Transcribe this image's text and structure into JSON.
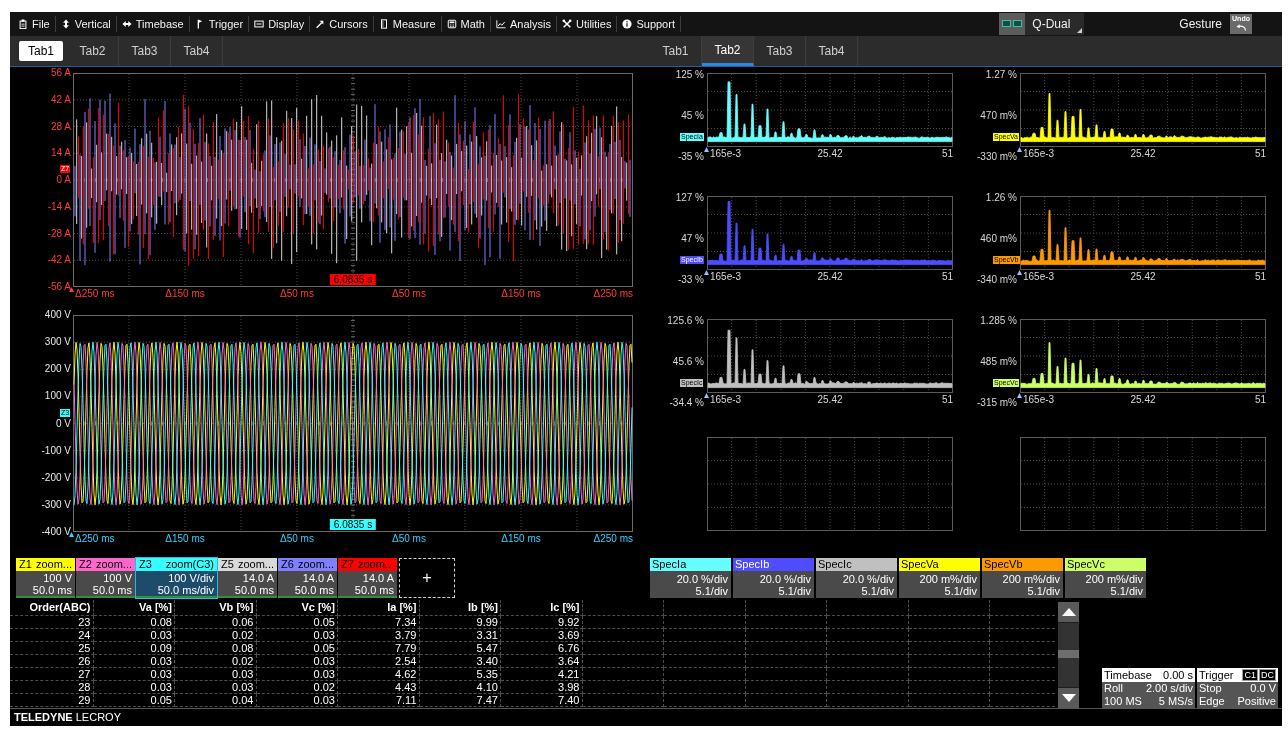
{
  "menu": {
    "items": [
      "File",
      "Vertical",
      "Timebase",
      "Trigger",
      "Display",
      "Cursors",
      "Measure",
      "Math",
      "Analysis",
      "Utilities",
      "Support"
    ],
    "display_mode": "Q-Dual",
    "gesture": "Gesture",
    "undo": "Undo"
  },
  "left_tabs": [
    {
      "label": "Tab1",
      "selected": true
    },
    {
      "label": "Tab2",
      "selected": false
    },
    {
      "label": "Tab3",
      "selected": false
    },
    {
      "label": "Tab4",
      "selected": false
    }
  ],
  "right_tabs": [
    {
      "label": "Tab1",
      "selected": false
    },
    {
      "label": "Tab2",
      "selected": true
    },
    {
      "label": "Tab3",
      "selected": false
    },
    {
      "label": "Tab4",
      "selected": false
    }
  ],
  "waveforms": [
    {
      "kind": "current",
      "tag": "Z7",
      "color": "#ff0000",
      "y_labels": [
        "56 A",
        "42 A",
        "28 A",
        "14 A",
        "0 A",
        "-14 A",
        "-28 A",
        "-42 A",
        "-56 A"
      ],
      "x_labels": [
        "Δ250 ms",
        "Δ150 ms",
        "Δ50 ms",
        "Δ50 ms",
        "Δ150 ms",
        "Δ250 ms"
      ],
      "cursor": "6.0835 s"
    },
    {
      "kind": "voltage",
      "tag": "Z3",
      "color": "#33ffff",
      "y_labels": [
        "400 V",
        "300 V",
        "200 V",
        "100 V",
        "0 V",
        "-100 V",
        "-200 V",
        "-300 V",
        "-400 V"
      ],
      "x_labels": [
        "Δ250 ms",
        "Δ150 ms",
        "Δ50 ms",
        "Δ50 ms",
        "Δ150 ms",
        "Δ250 ms"
      ],
      "cursor": "6.0835 s"
    }
  ],
  "spectra": [
    {
      "tag": "SpecIa",
      "color": "#66ffff",
      "y_labels": [
        "125 %",
        "45 %",
        "-35 %"
      ],
      "x_labels": [
        "165e-3",
        "25.42",
        "51"
      ]
    },
    {
      "tag": "SpecVa",
      "color": "#ffff00",
      "y_labels": [
        "1.27 %",
        "470 m%",
        "-330 m%"
      ],
      "x_labels": [
        "165e-3",
        "25.42",
        "51"
      ]
    },
    {
      "tag": "SpecIb",
      "color": "#4d4dff",
      "y_labels": [
        "127 %",
        "47 %",
        "-33 %"
      ],
      "x_labels": [
        "165e-3",
        "25.42",
        "51"
      ]
    },
    {
      "tag": "SpecVb",
      "color": "#ff9900",
      "y_labels": [
        "1.26 %",
        "460 m%",
        "-340 m%"
      ],
      "x_labels": [
        "165e-3",
        "25.42",
        "51"
      ]
    },
    {
      "tag": "SpecIc",
      "color": "#c0c0c0",
      "y_labels": [
        "125.6 %",
        "45.6 %",
        "-34.4 %"
      ],
      "x_labels": [
        "165e-3",
        "25.42",
        "51"
      ]
    },
    {
      "tag": "SpecVc",
      "color": "#ccff66",
      "y_labels": [
        "1.285 %",
        "485 m%",
        "-315 m%"
      ],
      "x_labels": [
        "165e-3",
        "25.42",
        "51"
      ]
    }
  ],
  "zoom_descriptors": [
    {
      "id": "Z1",
      "title": "zoom...",
      "color": "#ffff00",
      "scale": "100 V",
      "timebase": "50.0 ms",
      "selected": false
    },
    {
      "id": "Z2",
      "title": "zoom...",
      "color": "#ff66cc",
      "scale": "100 V",
      "timebase": "50.0 ms",
      "selected": false
    },
    {
      "id": "Z3",
      "title": "zoom(C3)",
      "color": "#33ffff",
      "scale": "100 V/div",
      "timebase": "50.0 ms/div",
      "selected": true
    },
    {
      "id": "Z5",
      "title": "zoom...",
      "color": "#d9d9d9",
      "scale": "14.0 A",
      "timebase": "50.0 ms",
      "selected": false
    },
    {
      "id": "Z6",
      "title": "zoom...",
      "color": "#8080ff",
      "scale": "14.0 A",
      "timebase": "50.0 ms",
      "selected": false
    },
    {
      "id": "Z7",
      "title": "zoom...",
      "color": "#ff0000",
      "scale": "14.0 A",
      "timebase": "50.0 ms",
      "selected": false
    }
  ],
  "add_trace": "+",
  "spectrum_descriptors": [
    {
      "title": "SpecIa",
      "color": "#66ffff",
      "scale": "20.0 %/div",
      "horizontal": "5.1/div"
    },
    {
      "title": "SpecIb",
      "color": "#4d4dff",
      "scale": "20.0 %/div",
      "horizontal": "5.1/div"
    },
    {
      "title": "SpecIc",
      "color": "#c0c0c0",
      "scale": "20.0 %/div",
      "horizontal": "5.1/div"
    },
    {
      "title": "SpecVa",
      "color": "#ffff00",
      "scale": "200 m%/div",
      "horizontal": "5.1/div"
    },
    {
      "title": "SpecVb",
      "color": "#ff9900",
      "scale": "200 m%/div",
      "horizontal": "5.1/div"
    },
    {
      "title": "SpecVc",
      "color": "#ccff66",
      "scale": "200 m%/div",
      "horizontal": "5.1/div"
    }
  ],
  "table": {
    "columns": [
      "Order(ABC)",
      "Va [%]",
      "Vb [%]",
      "Vc [%]",
      "Ia [%]",
      "Ib [%]",
      "Ic [%]"
    ],
    "rows": [
      [
        "23",
        "0.08",
        "0.06",
        "0.05",
        "7.34",
        "9.99",
        "9.92"
      ],
      [
        "24",
        "0.03",
        "0.02",
        "0.03",
        "3.79",
        "3.31",
        "3.69"
      ],
      [
        "25",
        "0.09",
        "0.08",
        "0.05",
        "7.79",
        "5.47",
        "6.76"
      ],
      [
        "26",
        "0.03",
        "0.02",
        "0.03",
        "2.54",
        "3.40",
        "3.64"
      ],
      [
        "27",
        "0.03",
        "0.03",
        "0.03",
        "4.62",
        "5.35",
        "4.21"
      ],
      [
        "28",
        "0.03",
        "0.03",
        "0.02",
        "4.43",
        "4.10",
        "3.98"
      ],
      [
        "29",
        "0.05",
        "0.04",
        "0.03",
        "7.11",
        "7.47",
        "7.40"
      ]
    ]
  },
  "timebase": {
    "title": "Timebase",
    "value": "0.00 s",
    "rows": [
      [
        "Roll",
        "2.00 s/div"
      ],
      [
        "100 MS",
        "5 MS/s"
      ]
    ]
  },
  "trigger": {
    "title": "Trigger",
    "badges": [
      "C1",
      "DC"
    ],
    "rows": [
      [
        "Stop",
        "0.0 V"
      ],
      [
        "Edge",
        "Positive"
      ]
    ]
  },
  "footer": {
    "brand": "**TELEDYNE** LECROY"
  }
}
